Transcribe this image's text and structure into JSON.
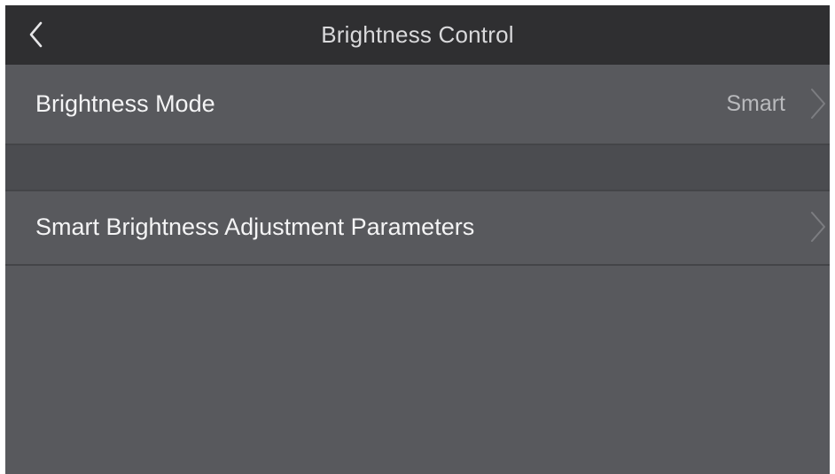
{
  "header": {
    "title": "Brightness Control",
    "back_icon": "chevron-left-icon"
  },
  "settings": [
    {
      "label": "Brightness Mode",
      "value": "Smart",
      "icon": "chevron-right-icon"
    },
    {
      "label": "Smart Brightness Adjustment Parameters",
      "icon": "chevron-right-icon"
    }
  ],
  "colors": {
    "title_bar": "#2f2f31",
    "background": "#58595d",
    "section_gap": "#4b4c50",
    "divider": "#444548",
    "label_text": "#f4f4f5",
    "value_text": "#b9babd",
    "title_text": "#d9d9db"
  }
}
